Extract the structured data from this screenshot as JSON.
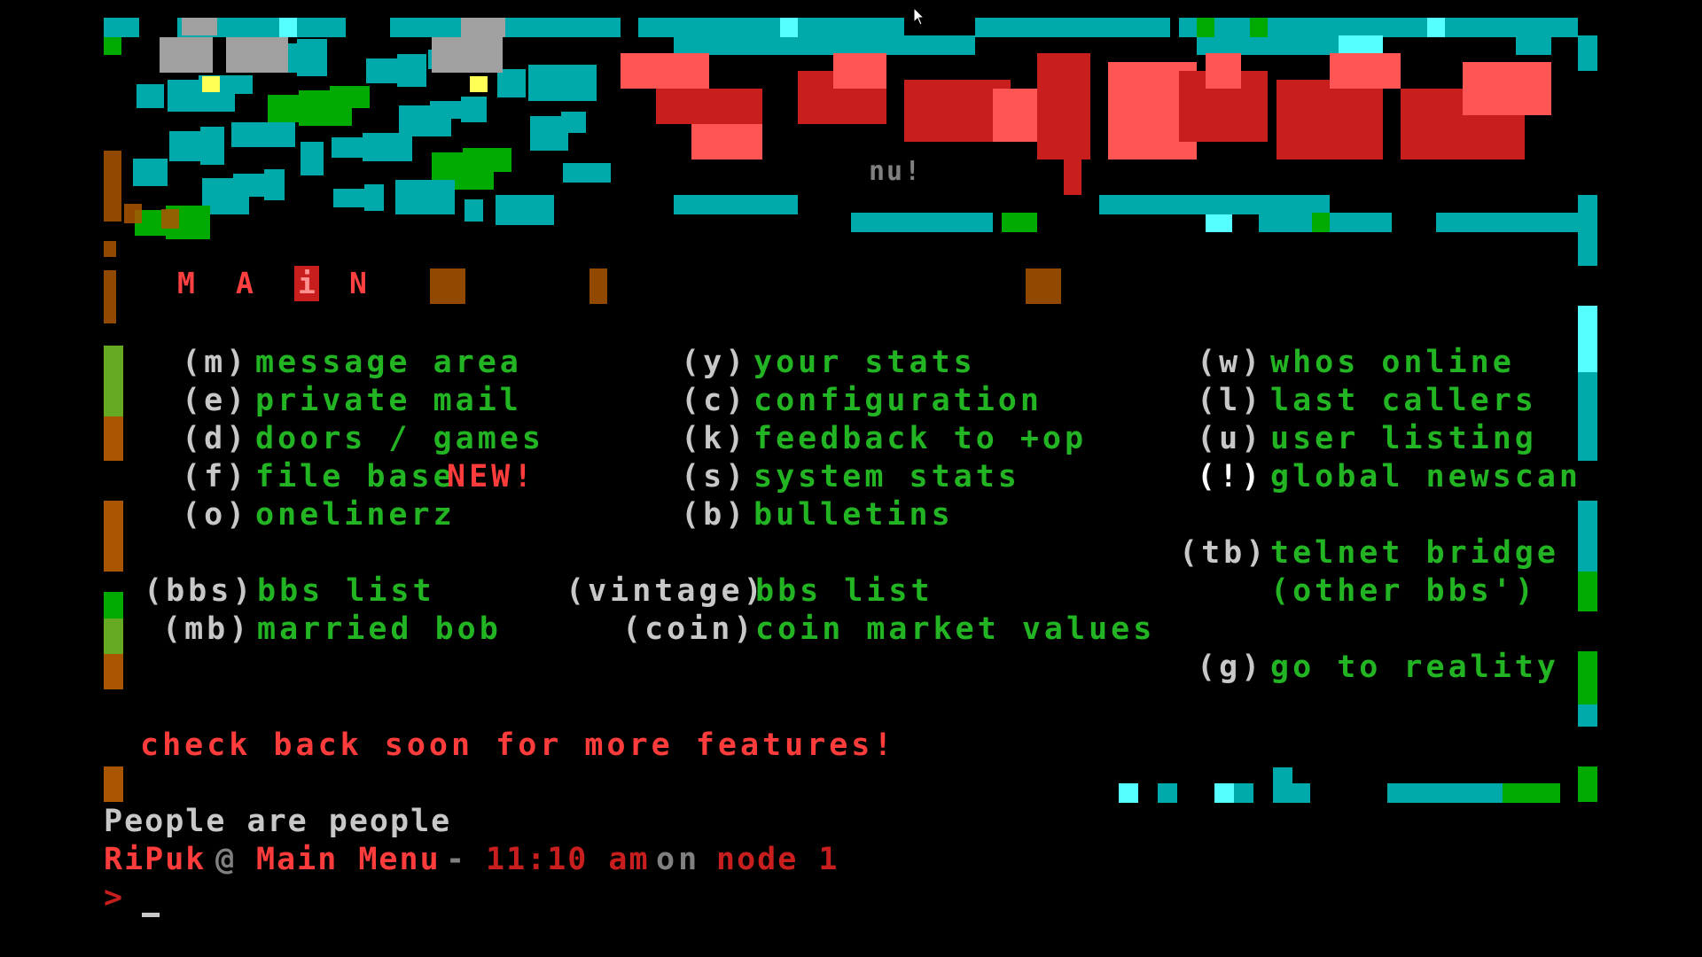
{
  "header": {
    "art_tag": "nu!"
  },
  "main_label": {
    "letters": [
      "M",
      "A",
      "i",
      "N"
    ]
  },
  "menu": {
    "col1": [
      {
        "key": "(m)",
        "label": "message area"
      },
      {
        "key": "(e)",
        "label": "private mail"
      },
      {
        "key": "(d)",
        "label": "doors / games"
      },
      {
        "key": "(f)",
        "label": "file base",
        "badge": "NEW!"
      },
      {
        "key": "(o)",
        "label": "onelinerz"
      }
    ],
    "col2": [
      {
        "key": "(y)",
        "label": "your stats"
      },
      {
        "key": "(c)",
        "label": "configuration"
      },
      {
        "key": "(k)",
        "label": "feedback to +op"
      },
      {
        "key": "(s)",
        "label": "system stats"
      },
      {
        "key": "(b)",
        "label": "bulletins"
      }
    ],
    "col3": [
      {
        "key": "(w)",
        "label": "whos online"
      },
      {
        "key": "(l)",
        "label": "last callers"
      },
      {
        "key": "(u)",
        "label": "user listing"
      },
      {
        "key": "(!)",
        "label": "global newscan"
      }
    ],
    "extra_left": [
      {
        "key": "(bbs)",
        "label": "bbs list"
      },
      {
        "key": "(mb)",
        "label": "married bob"
      }
    ],
    "extra_mid": [
      {
        "key": "(vintage)",
        "label": "bbs list"
      },
      {
        "key": "(coin)",
        "label": "coin market values"
      }
    ],
    "extra_right": [
      {
        "key": "(tb)",
        "label": "telnet bridge",
        "sub": "(other bbs')"
      },
      {
        "key": "(g)",
        "label": "go to reality"
      }
    ]
  },
  "notice": "check back soon for more features!",
  "status": {
    "quote": "People are people",
    "user": "RiPuk",
    "at": "@",
    "location": "Main Menu",
    "dash": "-",
    "time": "11:10 am",
    "on": "on",
    "node": "node 1"
  },
  "prompt": {
    "symbol": ">"
  },
  "colors": {
    "cyan": "#00aaaa",
    "green": "#00aa00",
    "red": "#c81e1e",
    "brightred": "#ff5555",
    "orange": "#aa5500"
  }
}
